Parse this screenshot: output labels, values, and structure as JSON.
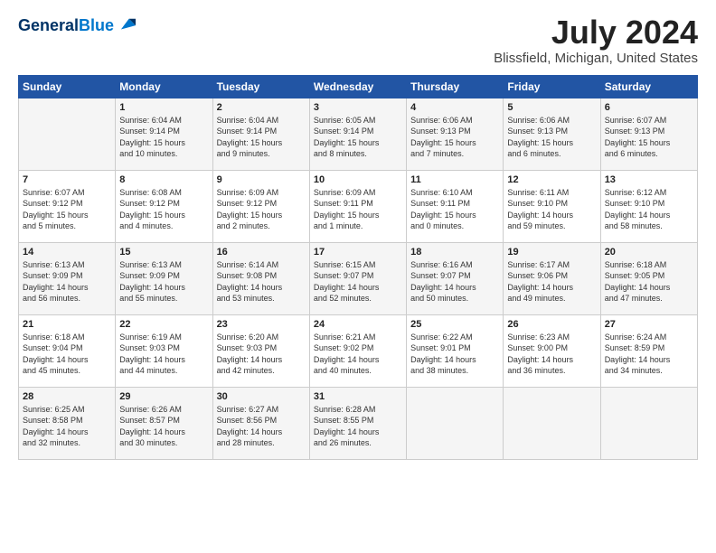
{
  "header": {
    "logo_line1": "General",
    "logo_line2": "Blue",
    "title": "July 2024",
    "subtitle": "Blissfield, Michigan, United States"
  },
  "days_of_week": [
    "Sunday",
    "Monday",
    "Tuesday",
    "Wednesday",
    "Thursday",
    "Friday",
    "Saturday"
  ],
  "weeks": [
    [
      {
        "day": "",
        "info": ""
      },
      {
        "day": "1",
        "info": "Sunrise: 6:04 AM\nSunset: 9:14 PM\nDaylight: 15 hours\nand 10 minutes."
      },
      {
        "day": "2",
        "info": "Sunrise: 6:04 AM\nSunset: 9:14 PM\nDaylight: 15 hours\nand 9 minutes."
      },
      {
        "day": "3",
        "info": "Sunrise: 6:05 AM\nSunset: 9:14 PM\nDaylight: 15 hours\nand 8 minutes."
      },
      {
        "day": "4",
        "info": "Sunrise: 6:06 AM\nSunset: 9:13 PM\nDaylight: 15 hours\nand 7 minutes."
      },
      {
        "day": "5",
        "info": "Sunrise: 6:06 AM\nSunset: 9:13 PM\nDaylight: 15 hours\nand 6 minutes."
      },
      {
        "day": "6",
        "info": "Sunrise: 6:07 AM\nSunset: 9:13 PM\nDaylight: 15 hours\nand 6 minutes."
      }
    ],
    [
      {
        "day": "7",
        "info": "Sunrise: 6:07 AM\nSunset: 9:12 PM\nDaylight: 15 hours\nand 5 minutes."
      },
      {
        "day": "8",
        "info": "Sunrise: 6:08 AM\nSunset: 9:12 PM\nDaylight: 15 hours\nand 4 minutes."
      },
      {
        "day": "9",
        "info": "Sunrise: 6:09 AM\nSunset: 9:12 PM\nDaylight: 15 hours\nand 2 minutes."
      },
      {
        "day": "10",
        "info": "Sunrise: 6:09 AM\nSunset: 9:11 PM\nDaylight: 15 hours\nand 1 minute."
      },
      {
        "day": "11",
        "info": "Sunrise: 6:10 AM\nSunset: 9:11 PM\nDaylight: 15 hours\nand 0 minutes."
      },
      {
        "day": "12",
        "info": "Sunrise: 6:11 AM\nSunset: 9:10 PM\nDaylight: 14 hours\nand 59 minutes."
      },
      {
        "day": "13",
        "info": "Sunrise: 6:12 AM\nSunset: 9:10 PM\nDaylight: 14 hours\nand 58 minutes."
      }
    ],
    [
      {
        "day": "14",
        "info": "Sunrise: 6:13 AM\nSunset: 9:09 PM\nDaylight: 14 hours\nand 56 minutes."
      },
      {
        "day": "15",
        "info": "Sunrise: 6:13 AM\nSunset: 9:09 PM\nDaylight: 14 hours\nand 55 minutes."
      },
      {
        "day": "16",
        "info": "Sunrise: 6:14 AM\nSunset: 9:08 PM\nDaylight: 14 hours\nand 53 minutes."
      },
      {
        "day": "17",
        "info": "Sunrise: 6:15 AM\nSunset: 9:07 PM\nDaylight: 14 hours\nand 52 minutes."
      },
      {
        "day": "18",
        "info": "Sunrise: 6:16 AM\nSunset: 9:07 PM\nDaylight: 14 hours\nand 50 minutes."
      },
      {
        "day": "19",
        "info": "Sunrise: 6:17 AM\nSunset: 9:06 PM\nDaylight: 14 hours\nand 49 minutes."
      },
      {
        "day": "20",
        "info": "Sunrise: 6:18 AM\nSunset: 9:05 PM\nDaylight: 14 hours\nand 47 minutes."
      }
    ],
    [
      {
        "day": "21",
        "info": "Sunrise: 6:18 AM\nSunset: 9:04 PM\nDaylight: 14 hours\nand 45 minutes."
      },
      {
        "day": "22",
        "info": "Sunrise: 6:19 AM\nSunset: 9:03 PM\nDaylight: 14 hours\nand 44 minutes."
      },
      {
        "day": "23",
        "info": "Sunrise: 6:20 AM\nSunset: 9:03 PM\nDaylight: 14 hours\nand 42 minutes."
      },
      {
        "day": "24",
        "info": "Sunrise: 6:21 AM\nSunset: 9:02 PM\nDaylight: 14 hours\nand 40 minutes."
      },
      {
        "day": "25",
        "info": "Sunrise: 6:22 AM\nSunset: 9:01 PM\nDaylight: 14 hours\nand 38 minutes."
      },
      {
        "day": "26",
        "info": "Sunrise: 6:23 AM\nSunset: 9:00 PM\nDaylight: 14 hours\nand 36 minutes."
      },
      {
        "day": "27",
        "info": "Sunrise: 6:24 AM\nSunset: 8:59 PM\nDaylight: 14 hours\nand 34 minutes."
      }
    ],
    [
      {
        "day": "28",
        "info": "Sunrise: 6:25 AM\nSunset: 8:58 PM\nDaylight: 14 hours\nand 32 minutes."
      },
      {
        "day": "29",
        "info": "Sunrise: 6:26 AM\nSunset: 8:57 PM\nDaylight: 14 hours\nand 30 minutes."
      },
      {
        "day": "30",
        "info": "Sunrise: 6:27 AM\nSunset: 8:56 PM\nDaylight: 14 hours\nand 28 minutes."
      },
      {
        "day": "31",
        "info": "Sunrise: 6:28 AM\nSunset: 8:55 PM\nDaylight: 14 hours\nand 26 minutes."
      },
      {
        "day": "",
        "info": ""
      },
      {
        "day": "",
        "info": ""
      },
      {
        "day": "",
        "info": ""
      }
    ]
  ]
}
